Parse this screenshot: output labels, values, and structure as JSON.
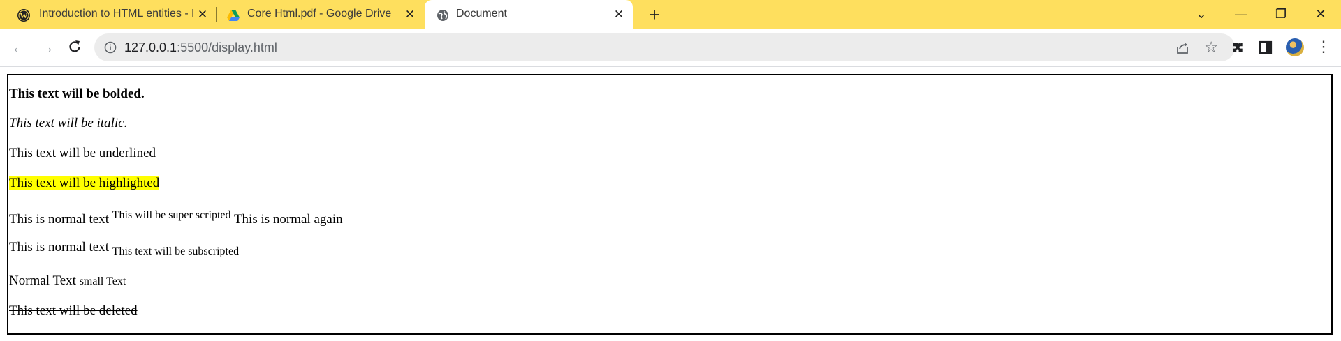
{
  "browser": {
    "tabs": [
      {
        "title": "Introduction to HTML entities - F",
        "icon": "wordpress-icon",
        "active": false
      },
      {
        "title": "Core Html.pdf - Google Drive",
        "icon": "google-drive-icon",
        "active": false
      },
      {
        "title": "Document",
        "icon": "globe-icon",
        "active": true
      }
    ],
    "new_tab_label": "+",
    "address": {
      "host": "127.0.0.1",
      "path": ":5500/display.html"
    },
    "accent_color": "#fedf5e"
  },
  "document": {
    "bold": "This text will be bolded.",
    "italic": "This text will be italic.",
    "underline": "This text will be underlined",
    "highlight": "This text will be highlighted",
    "sup_line": {
      "before": "This is normal text",
      "sup": "This will be super scripted",
      "after": "This is normal again"
    },
    "sub_line": {
      "before": "This is normal text",
      "sub": "This text will be subscripted"
    },
    "small_line": {
      "normal": "Normal Text",
      "small": "small Text"
    },
    "deleted": "This text will be deleted"
  }
}
